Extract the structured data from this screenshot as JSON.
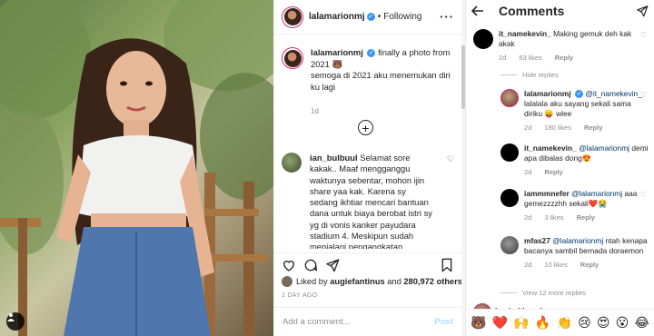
{
  "post": {
    "username": "lalamarionmj",
    "following_label": "Following",
    "caption_line1": "finally a photo from 2021 🐻",
    "caption_line2": "semoga di 2021 aku menemukan diri ku lagi",
    "caption_time": "1d",
    "comment1_user": "ian_bulbuul",
    "comment1_text": "Selamat sore kakak.. Maaf mengganggu waktunya sebentar, mohon ijin share yaa kak. Karena sy sedang ikhtiar mencari bantuan dana untuk biaya berobat istri sy yg di vonis kanker payudara stadium 4. Meskipun sudah menjalani pengangkatan payudara & induna tekornya. Istri ay msih",
    "liked_by_prefix": "Liked by",
    "liked_by_user": "augiefantinus",
    "liked_by_and": "and",
    "liked_by_count": "280,972 others",
    "date": "1 DAY AGO",
    "add_comment_placeholder": "Add a comment...",
    "post_button": "Post"
  },
  "mobile": {
    "title": "Comments",
    "hide_replies": "Hide replies",
    "view_more": "View 12 more replies",
    "peek_user": "bapiodthyeabye",
    "comments": [
      {
        "user": "it_namekevin_",
        "mention": "",
        "text": "Making gemuk deh kak akak",
        "time": "2d",
        "likes": "63 likes",
        "reply": "Reply"
      },
      {
        "user": "lalamarionmj",
        "mention": "@it_namekevin_",
        "text": "lalalala aku sayang sekali sama diriku 😛 wlee",
        "time": "2d",
        "likes": "180 likes",
        "reply": "Reply"
      },
      {
        "user": "it_namekevin_",
        "mention": "@lalamarionmj",
        "text": "demi apa dibalas dong😍",
        "time": "2d",
        "likes": "",
        "reply": "Reply"
      },
      {
        "user": "iammmnefer",
        "mention": "@lalamarionmj",
        "text": "aaa gemezzzzhh sekali❤️😭",
        "time": "2d",
        "likes": "3 likes",
        "reply": "Reply"
      },
      {
        "user": "mfas27",
        "mention": "@lalamarionmj",
        "text": "ntah kenapa bacanya sambil bernada doraemon",
        "time": "2d",
        "likes": "10 likes",
        "reply": "Reply"
      }
    ],
    "emojis": [
      "🐻",
      "❤️",
      "🙌",
      "🔥",
      "👏",
      "😢",
      "😍",
      "😮",
      "😂"
    ]
  },
  "colors": {
    "verified": "#3897f0",
    "mention": "#00376b",
    "meta_gray": "#8e8e8e",
    "post_disabled": "#b2dffc",
    "story_ring": "#d62976"
  }
}
